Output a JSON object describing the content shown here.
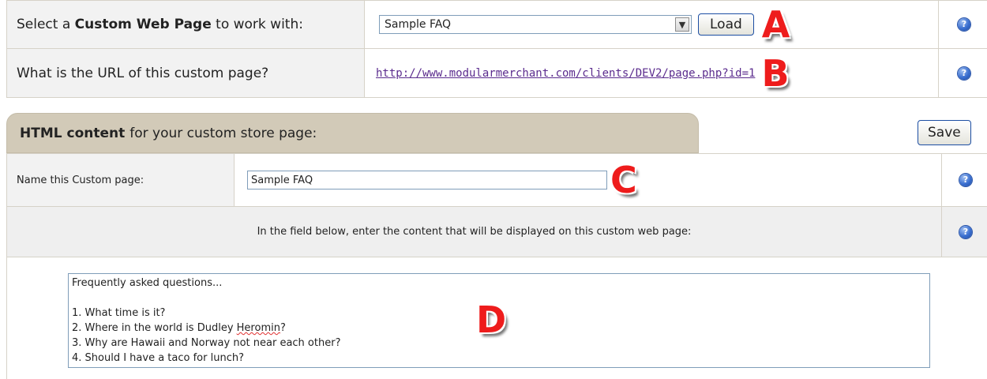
{
  "select_page": {
    "label_prefix": "Select a ",
    "label_bold": "Custom Web Page",
    "label_suffix": " to work with:",
    "selected_value": "Sample FAQ",
    "load_label": "Load",
    "marker": "A",
    "help": "?"
  },
  "url_row": {
    "label": "What is the URL of this custom page?",
    "url": "http://www.modularmerchant.com/clients/DEV2/page.php?id=1",
    "marker": "B",
    "help": "?"
  },
  "html_tab": {
    "bold": "HTML content",
    "rest": "for your custom store page:",
    "save_label": "Save"
  },
  "name_row": {
    "label": "Name this Custom page:",
    "value": "Sample FAQ",
    "marker": "C",
    "help": "?"
  },
  "instruction_row": {
    "text": "In the field below, enter the content that will be displayed on this custom web page:",
    "help": "?"
  },
  "content_editor": {
    "line_1": "Frequently asked questions...",
    "line_2": "",
    "line_3": "1. What time is it?",
    "line_4_before": "2. Where in the world is Dudley ",
    "line_4_misspelled": "Heromin",
    "line_4_after": "?",
    "line_5": "3. Why are Hawaii and Norway not near each other?",
    "line_6": "4. Should I have a taco for lunch?",
    "marker": "D"
  },
  "colors": {
    "marker_red": "#ee1c1c",
    "tab_bg": "#d2cab8",
    "link": "#5b2c8e",
    "help_blue": "#3a6fd0"
  }
}
